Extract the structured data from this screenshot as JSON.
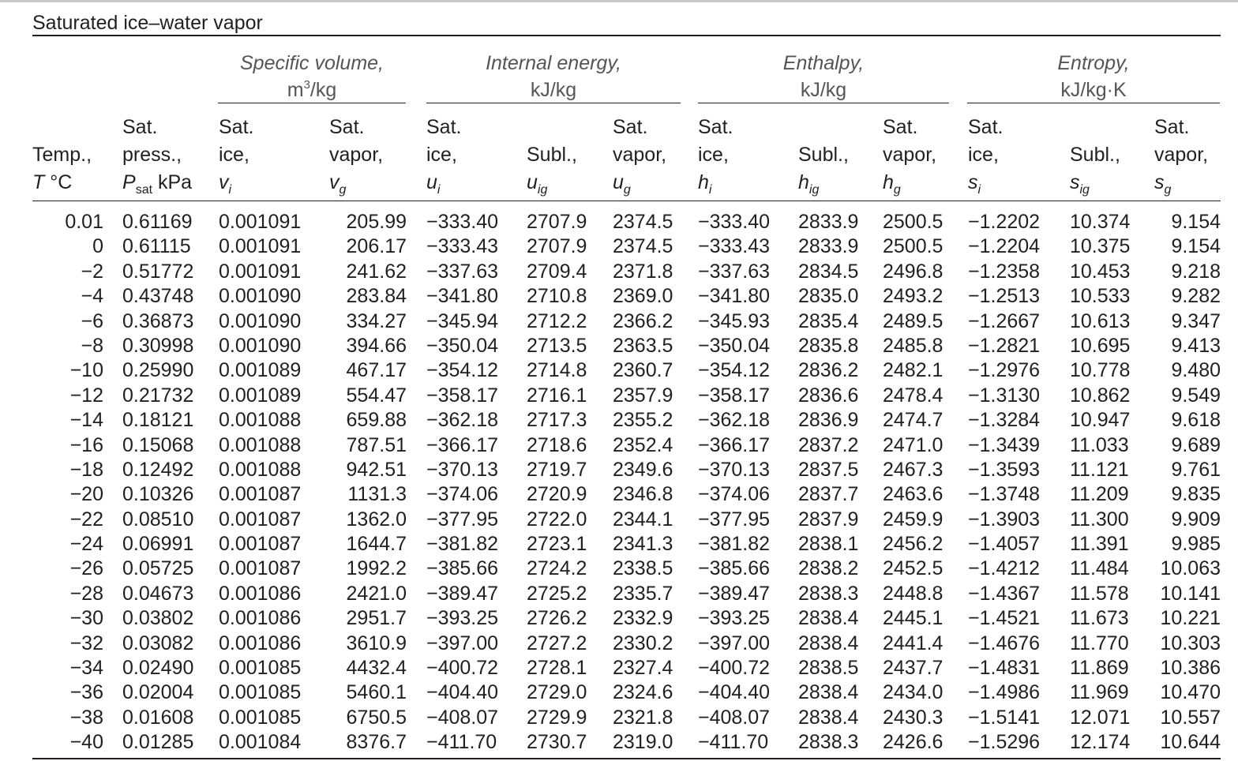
{
  "table": {
    "title": "Saturated ice–water vapor",
    "groups": [
      {
        "name": "Specific volume,",
        "unit_pre": "m",
        "unit_sup": "3",
        "unit_post": "/kg"
      },
      {
        "name": "Internal energy,",
        "unit_pre": "kJ/kg",
        "unit_sup": "",
        "unit_post": ""
      },
      {
        "name": "Enthalpy,",
        "unit_pre": "kJ/kg",
        "unit_sup": "",
        "unit_post": ""
      },
      {
        "name": "Entropy,",
        "unit_pre": "kJ/kg·K",
        "unit_sup": "",
        "unit_post": ""
      }
    ],
    "columns": [
      {
        "lines": [
          "",
          "Temp.,"
        ],
        "sym": "T",
        "sub": "",
        "tail": " °C"
      },
      {
        "lines": [
          "Sat.",
          "press.,"
        ],
        "sym": "P",
        "sub_normal": "sat",
        "tail": " kPa"
      },
      {
        "lines": [
          "Sat.",
          "ice,"
        ],
        "sym": "v",
        "sub": "i",
        "tail": ""
      },
      {
        "lines": [
          "Sat.",
          "vapor,"
        ],
        "sym": "v",
        "sub": "g",
        "tail": ""
      },
      {
        "lines": [
          "Sat.",
          "ice,"
        ],
        "sym": "u",
        "sub": "i",
        "tail": ""
      },
      {
        "lines": [
          "",
          "Subl.,"
        ],
        "sym": "u",
        "sub": "ig",
        "tail": ""
      },
      {
        "lines": [
          "Sat.",
          "vapor,"
        ],
        "sym": "u",
        "sub": "g",
        "tail": ""
      },
      {
        "lines": [
          "Sat.",
          "ice,"
        ],
        "sym": "h",
        "sub": "i",
        "tail": ""
      },
      {
        "lines": [
          "",
          "Subl.,"
        ],
        "sym": "h",
        "sub": "ig",
        "tail": ""
      },
      {
        "lines": [
          "Sat.",
          "vapor,"
        ],
        "sym": "h",
        "sub": "g",
        "tail": ""
      },
      {
        "lines": [
          "Sat.",
          "ice,"
        ],
        "sym": "s",
        "sub": "i",
        "tail": ""
      },
      {
        "lines": [
          "",
          "Subl.,"
        ],
        "sym": "s",
        "sub": "ig",
        "tail": ""
      },
      {
        "lines": [
          "Sat.",
          "vapor,"
        ],
        "sym": "s",
        "sub": "g",
        "tail": ""
      }
    ],
    "rows": [
      [
        "0.01",
        "0.61169",
        "0.001091",
        "205.99",
        "−333.40",
        "2707.9",
        "2374.5",
        "−333.40",
        "2833.9",
        "2500.5",
        "−1.2202",
        "10.374",
        "9.154"
      ],
      [
        "0",
        "0.61115",
        "0.001091",
        "206.17",
        "−333.43",
        "2707.9",
        "2374.5",
        "−333.43",
        "2833.9",
        "2500.5",
        "−1.2204",
        "10.375",
        "9.154"
      ],
      [
        "−2",
        "0.51772",
        "0.001091",
        "241.62",
        "−337.63",
        "2709.4",
        "2371.8",
        "−337.63",
        "2834.5",
        "2496.8",
        "−1.2358",
        "10.453",
        "9.218"
      ],
      [
        "−4",
        "0.43748",
        "0.001090",
        "283.84",
        "−341.80",
        "2710.8",
        "2369.0",
        "−341.80",
        "2835.0",
        "2493.2",
        "−1.2513",
        "10.533",
        "9.282"
      ],
      [
        "−6",
        "0.36873",
        "0.001090",
        "334.27",
        "−345.94",
        "2712.2",
        "2366.2",
        "−345.93",
        "2835.4",
        "2489.5",
        "−1.2667",
        "10.613",
        "9.347"
      ],
      [
        "−8",
        "0.30998",
        "0.001090",
        "394.66",
        "−350.04",
        "2713.5",
        "2363.5",
        "−350.04",
        "2835.8",
        "2485.8",
        "−1.2821",
        "10.695",
        "9.413"
      ],
      [
        "−10",
        "0.25990",
        "0.001089",
        "467.17",
        "−354.12",
        "2714.8",
        "2360.7",
        "−354.12",
        "2836.2",
        "2482.1",
        "−1.2976",
        "10.778",
        "9.480"
      ],
      [
        "−12",
        "0.21732",
        "0.001089",
        "554.47",
        "−358.17",
        "2716.1",
        "2357.9",
        "−358.17",
        "2836.6",
        "2478.4",
        "−1.3130",
        "10.862",
        "9.549"
      ],
      [
        "−14",
        "0.18121",
        "0.001088",
        "659.88",
        "−362.18",
        "2717.3",
        "2355.2",
        "−362.18",
        "2836.9",
        "2474.7",
        "−1.3284",
        "10.947",
        "9.618"
      ],
      [
        "−16",
        "0.15068",
        "0.001088",
        "787.51",
        "−366.17",
        "2718.6",
        "2352.4",
        "−366.17",
        "2837.2",
        "2471.0",
        "−1.3439",
        "11.033",
        "9.689"
      ],
      [
        "−18",
        "0.12492",
        "0.001088",
        "942.51",
        "−370.13",
        "2719.7",
        "2349.6",
        "−370.13",
        "2837.5",
        "2467.3",
        "−1.3593",
        "11.121",
        "9.761"
      ],
      [
        "−20",
        "0.10326",
        "0.001087",
        "1131.3",
        "−374.06",
        "2720.9",
        "2346.8",
        "−374.06",
        "2837.7",
        "2463.6",
        "−1.3748",
        "11.209",
        "9.835"
      ],
      [
        "−22",
        "0.08510",
        "0.001087",
        "1362.0",
        "−377.95",
        "2722.0",
        "2344.1",
        "−377.95",
        "2837.9",
        "2459.9",
        "−1.3903",
        "11.300",
        "9.909"
      ],
      [
        "−24",
        "0.06991",
        "0.001087",
        "1644.7",
        "−381.82",
        "2723.1",
        "2341.3",
        "−381.82",
        "2838.1",
        "2456.2",
        "−1.4057",
        "11.391",
        "9.985"
      ],
      [
        "−26",
        "0.05725",
        "0.001087",
        "1992.2",
        "−385.66",
        "2724.2",
        "2338.5",
        "−385.66",
        "2838.2",
        "2452.5",
        "−1.4212",
        "11.484",
        "10.063"
      ],
      [
        "−28",
        "0.04673",
        "0.001086",
        "2421.0",
        "−389.47",
        "2725.2",
        "2335.7",
        "−389.47",
        "2838.3",
        "2448.8",
        "−1.4367",
        "11.578",
        "10.141"
      ],
      [
        "−30",
        "0.03802",
        "0.001086",
        "2951.7",
        "−393.25",
        "2726.2",
        "2332.9",
        "−393.25",
        "2838.4",
        "2445.1",
        "−1.4521",
        "11.673",
        "10.221"
      ],
      [
        "−32",
        "0.03082",
        "0.001086",
        "3610.9",
        "−397.00",
        "2727.2",
        "2330.2",
        "−397.00",
        "2838.4",
        "2441.4",
        "−1.4676",
        "11.770",
        "10.303"
      ],
      [
        "−34",
        "0.02490",
        "0.001085",
        "4432.4",
        "−400.72",
        "2728.1",
        "2327.4",
        "−400.72",
        "2838.5",
        "2437.7",
        "−1.4831",
        "11.869",
        "10.386"
      ],
      [
        "−36",
        "0.02004",
        "0.001085",
        "5460.1",
        "−404.40",
        "2729.0",
        "2324.6",
        "−404.40",
        "2838.4",
        "2434.0",
        "−1.4986",
        "11.969",
        "10.470"
      ],
      [
        "−38",
        "0.01608",
        "0.001085",
        "6750.5",
        "−408.07",
        "2729.9",
        "2321.8",
        "−408.07",
        "2838.4",
        "2430.3",
        "−1.5141",
        "12.071",
        "10.557"
      ],
      [
        "−40",
        "0.01285",
        "0.001084",
        "8376.7",
        "−411.70",
        "2730.7",
        "2319.0",
        "−411.70",
        "2838.3",
        "2426.6",
        "−1.5296",
        "12.174",
        "10.644"
      ]
    ]
  }
}
